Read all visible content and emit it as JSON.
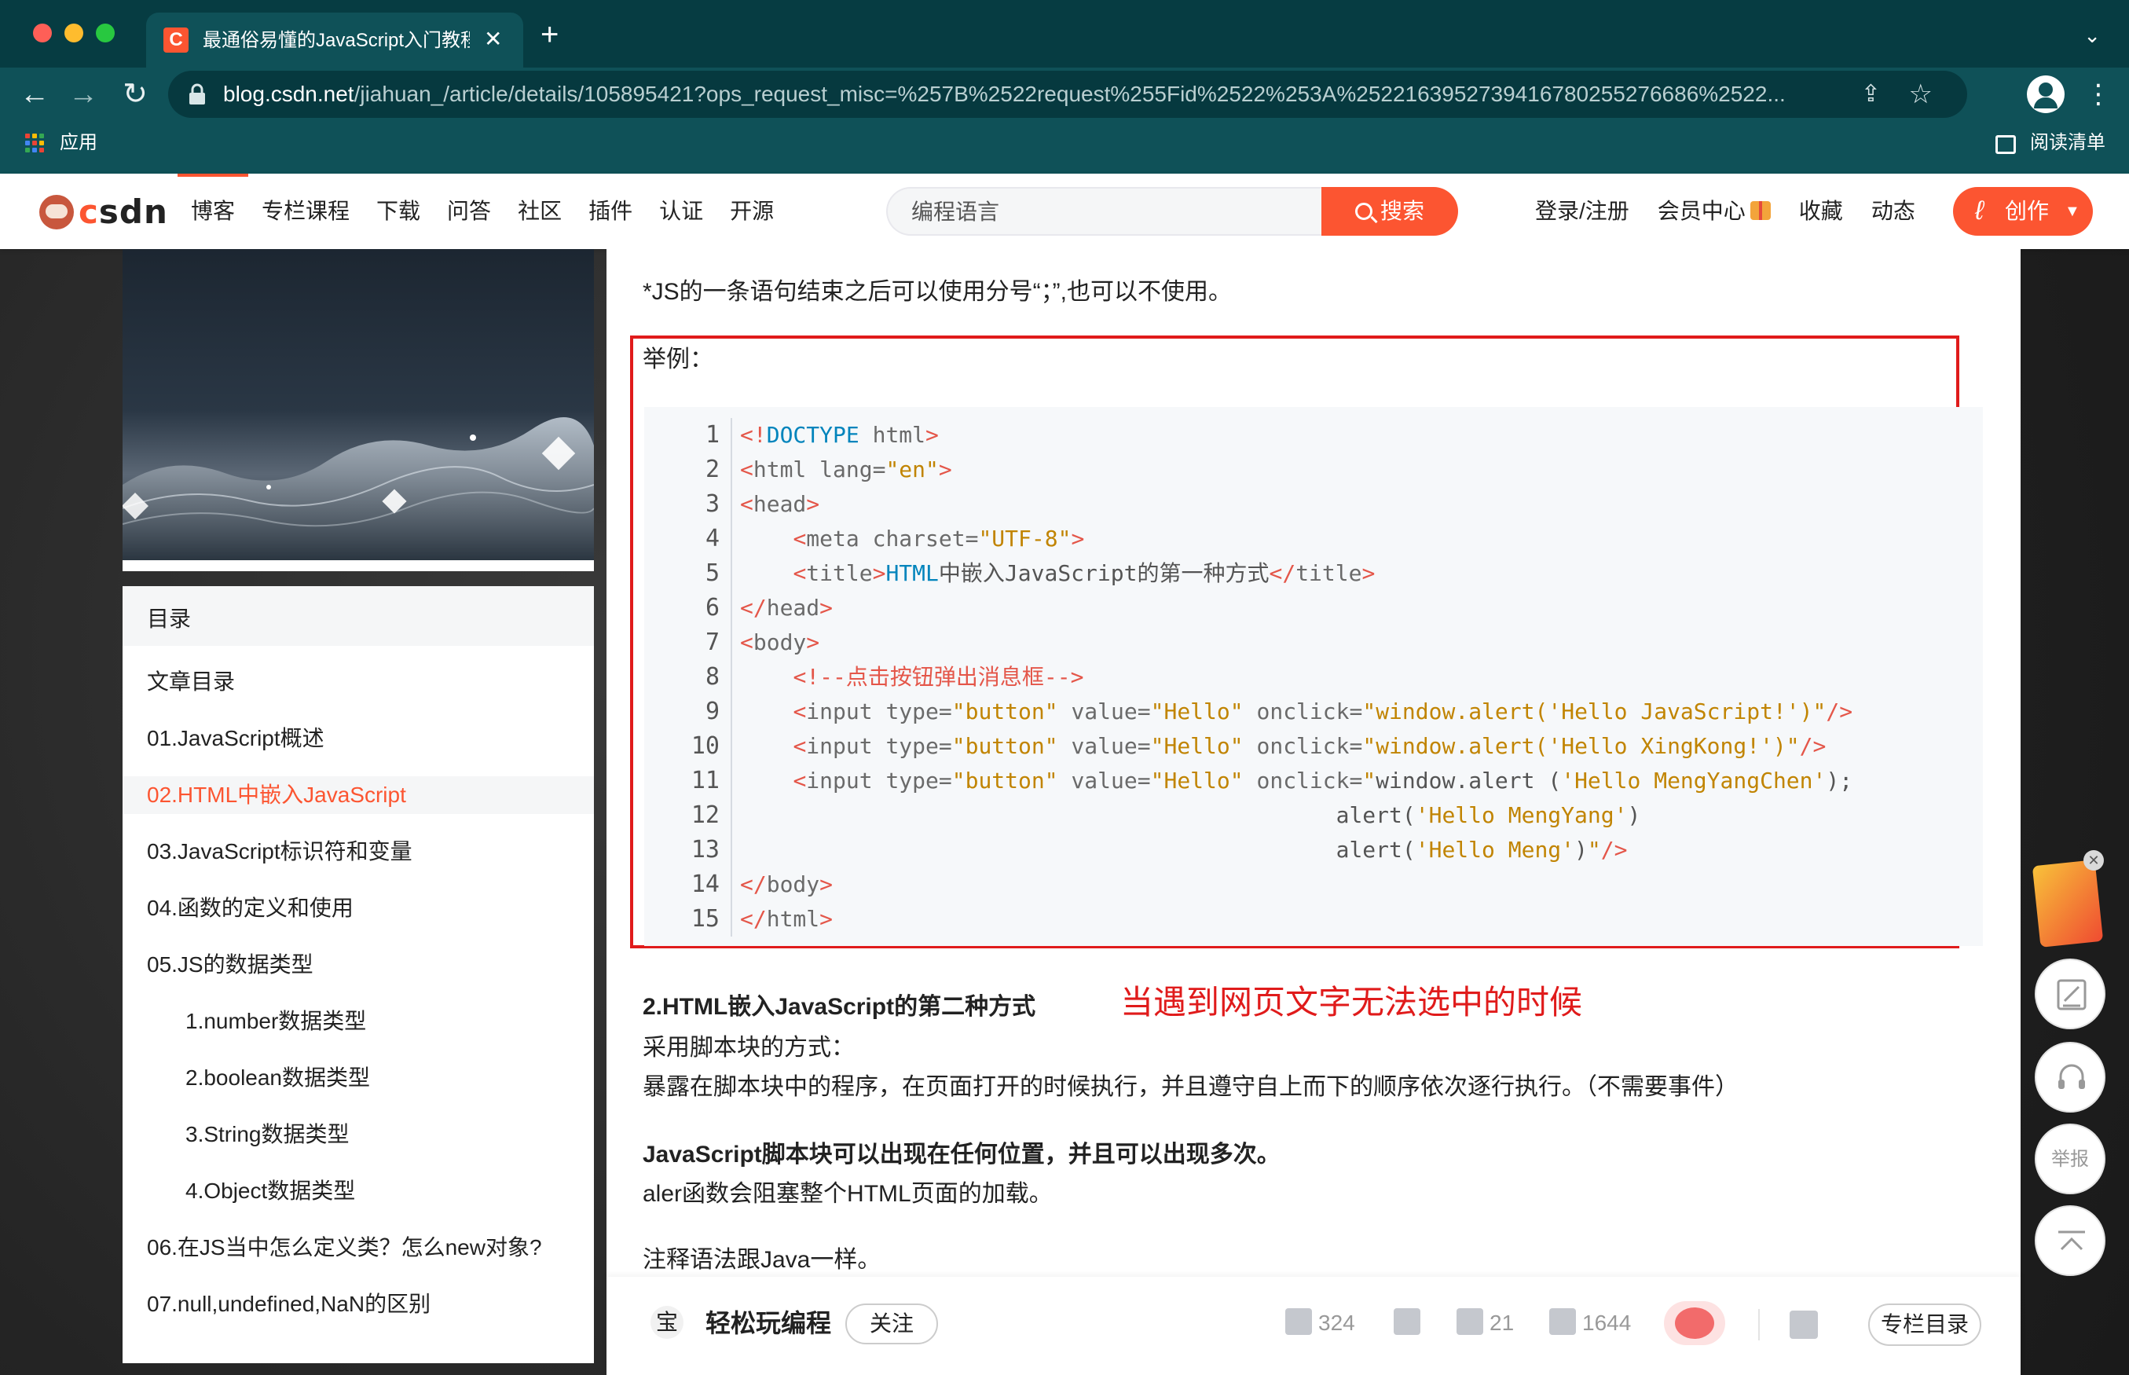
{
  "browser": {
    "tab_title": "最通俗易懂的JavaScript入门教程",
    "tab_favicon": "C",
    "url_host": "blog.csdn.net",
    "url_rest": "/jiahuan_/article/details/105895421?ops_request_misc=%257B%2522request%255Fid%2522%253A%2522163952739416780255276686%2522...",
    "bookmarks_apps": "应用",
    "reading_list": "阅读清单",
    "icons": [
      "back-icon",
      "forward-icon",
      "reload-icon",
      "lock-icon",
      "share-icon",
      "star-icon",
      "profile-icon",
      "kebab-icon",
      "apps-icon",
      "reading-list-icon"
    ]
  },
  "csdn_header": {
    "logo": "CSDN",
    "nav": [
      "博客",
      "专栏课程",
      "下载",
      "问答",
      "社区",
      "插件",
      "认证",
      "开源"
    ],
    "search_placeholder": "编程语言",
    "search_button": "搜索",
    "right_nav": [
      "登录/注册",
      "会员中心",
      "收藏",
      "动态"
    ],
    "create_button": "创作",
    "brand_color": "#fc5531"
  },
  "toc": {
    "header": "目录",
    "items": [
      {
        "label": "文章目录",
        "indent": 0,
        "active": false
      },
      {
        "label": "01.JavaScript概述",
        "indent": 0,
        "active": false
      },
      {
        "label": "02.HTML中嵌入JavaScript",
        "indent": 0,
        "active": true
      },
      {
        "label": "03.JavaScript标识符和变量",
        "indent": 0,
        "active": false
      },
      {
        "label": "04.函数的定义和使用",
        "indent": 0,
        "active": false
      },
      {
        "label": "05.JS的数据类型",
        "indent": 0,
        "active": false
      },
      {
        "label": "1.number数据类型",
        "indent": 1,
        "active": false
      },
      {
        "label": "2.boolean数据类型",
        "indent": 1,
        "active": false
      },
      {
        "label": "3.String数据类型",
        "indent": 1,
        "active": false
      },
      {
        "label": "4.Object数据类型",
        "indent": 1,
        "active": false
      },
      {
        "label": "06.在JS当中怎么定义类？怎么new对象?",
        "indent": 0,
        "active": false
      },
      {
        "label": "07.null,undefined,NaN的区别",
        "indent": 0,
        "active": false
      }
    ]
  },
  "article": {
    "intro": "*JS的一条语句结束之后可以使用分号“；”,也可以不使用。",
    "example_label": "举例：",
    "code_lines": [
      [
        {
          "c": "tg",
          "t": "<!"
        },
        {
          "c": "kw",
          "t": "DOCTYPE"
        },
        {
          "c": "at",
          "t": " html"
        },
        {
          "c": "tg",
          "t": ">"
        }
      ],
      [
        {
          "c": "tg",
          "t": "<"
        },
        {
          "c": "at",
          "t": "html lang="
        },
        {
          "c": "st",
          "t": "\"en\""
        },
        {
          "c": "tg",
          "t": ">"
        }
      ],
      [
        {
          "c": "tg",
          "t": "<"
        },
        {
          "c": "at",
          "t": "head"
        },
        {
          "c": "tg",
          "t": ">"
        }
      ],
      [
        {
          "c": "df",
          "t": "    "
        },
        {
          "c": "tg",
          "t": "<"
        },
        {
          "c": "at",
          "t": "meta charset="
        },
        {
          "c": "st",
          "t": "\"UTF-8\""
        },
        {
          "c": "tg",
          "t": ">"
        }
      ],
      [
        {
          "c": "df",
          "t": "    "
        },
        {
          "c": "tg",
          "t": "<"
        },
        {
          "c": "at",
          "t": "title"
        },
        {
          "c": "tg",
          "t": ">"
        },
        {
          "c": "tx",
          "t": "HTML"
        },
        {
          "c": "df",
          "t": "中嵌入JavaScript的第一种方式"
        },
        {
          "c": "tg",
          "t": "</"
        },
        {
          "c": "at",
          "t": "title"
        },
        {
          "c": "tg",
          "t": ">"
        }
      ],
      [
        {
          "c": "tg",
          "t": "</"
        },
        {
          "c": "at",
          "t": "head"
        },
        {
          "c": "tg",
          "t": ">"
        }
      ],
      [
        {
          "c": "tg",
          "t": "<"
        },
        {
          "c": "at",
          "t": "body"
        },
        {
          "c": "tg",
          "t": ">"
        }
      ],
      [
        {
          "c": "df",
          "t": "    "
        },
        {
          "c": "cm",
          "t": "<!--点击按钮弹出消息框-->"
        }
      ],
      [
        {
          "c": "df",
          "t": "    "
        },
        {
          "c": "tg",
          "t": "<"
        },
        {
          "c": "at",
          "t": "input type="
        },
        {
          "c": "st",
          "t": "\"button\""
        },
        {
          "c": "at",
          "t": " value="
        },
        {
          "c": "st",
          "t": "\"Hello\""
        },
        {
          "c": "at",
          "t": " onclick="
        },
        {
          "c": "st",
          "t": "\"window.alert('Hello JavaScript!')\""
        },
        {
          "c": "tg",
          "t": "/>"
        }
      ],
      [
        {
          "c": "df",
          "t": "    "
        },
        {
          "c": "tg",
          "t": "<"
        },
        {
          "c": "at",
          "t": "input type="
        },
        {
          "c": "st",
          "t": "\"button\""
        },
        {
          "c": "at",
          "t": " value="
        },
        {
          "c": "st",
          "t": "\"Hello\""
        },
        {
          "c": "at",
          "t": " onclick="
        },
        {
          "c": "st",
          "t": "\"window.alert('Hello XingKong!')\""
        },
        {
          "c": "tg",
          "t": "/>"
        }
      ],
      [
        {
          "c": "df",
          "t": "    "
        },
        {
          "c": "tg",
          "t": "<"
        },
        {
          "c": "at",
          "t": "input type="
        },
        {
          "c": "st",
          "t": "\"button\""
        },
        {
          "c": "at",
          "t": " value="
        },
        {
          "c": "st",
          "t": "\"Hello\""
        },
        {
          "c": "at",
          "t": " onclick="
        },
        {
          "c": "st",
          "t": "\""
        },
        {
          "c": "df",
          "t": "window.alert ("
        },
        {
          "c": "st",
          "t": "'Hello MengYangChen'"
        },
        {
          "c": "df",
          "t": ");"
        }
      ],
      [
        {
          "c": "df",
          "t": "                                             alert("
        },
        {
          "c": "st",
          "t": "'Hello MengYang'"
        },
        {
          "c": "df",
          "t": ")"
        }
      ],
      [
        {
          "c": "df",
          "t": "                                             alert("
        },
        {
          "c": "st",
          "t": "'Hello Meng'"
        },
        {
          "c": "df",
          "t": ")"
        },
        {
          "c": "st",
          "t": "\""
        },
        {
          "c": "tg",
          "t": "/>"
        }
      ],
      [
        {
          "c": "tg",
          "t": "</"
        },
        {
          "c": "at",
          "t": "body"
        },
        {
          "c": "tg",
          "t": ">"
        }
      ],
      [
        {
          "c": "tg",
          "t": "</"
        },
        {
          "c": "at",
          "t": "html"
        },
        {
          "c": "tg",
          "t": ">"
        }
      ]
    ],
    "section2_title": "2.HTML嵌入JavaScript的第二种方式",
    "annotation": "当遇到网页文字无法选中的时候",
    "p1": "采用脚本块的方式：",
    "p2": "暴露在脚本块中的程序，在页面打开的时候执行，并且遵守自上而下的顺序依次逐行执行。（不需要事件）",
    "p3_bold": "JavaScript脚本块可以出现在任何位置，并且可以出现多次。",
    "p4": "aler函数会阻塞整个HTML页面的加载。",
    "p5": "注释语法跟Java一样。",
    "highlight_color": "#e01b1b"
  },
  "footer": {
    "avatar_char": "宝",
    "author": "轻松玩编程",
    "follow": "关注",
    "likes": "324",
    "comments": "21",
    "favorites": "1644",
    "column_toc": "专栏目录"
  },
  "side_tools": {
    "report": "举报"
  }
}
